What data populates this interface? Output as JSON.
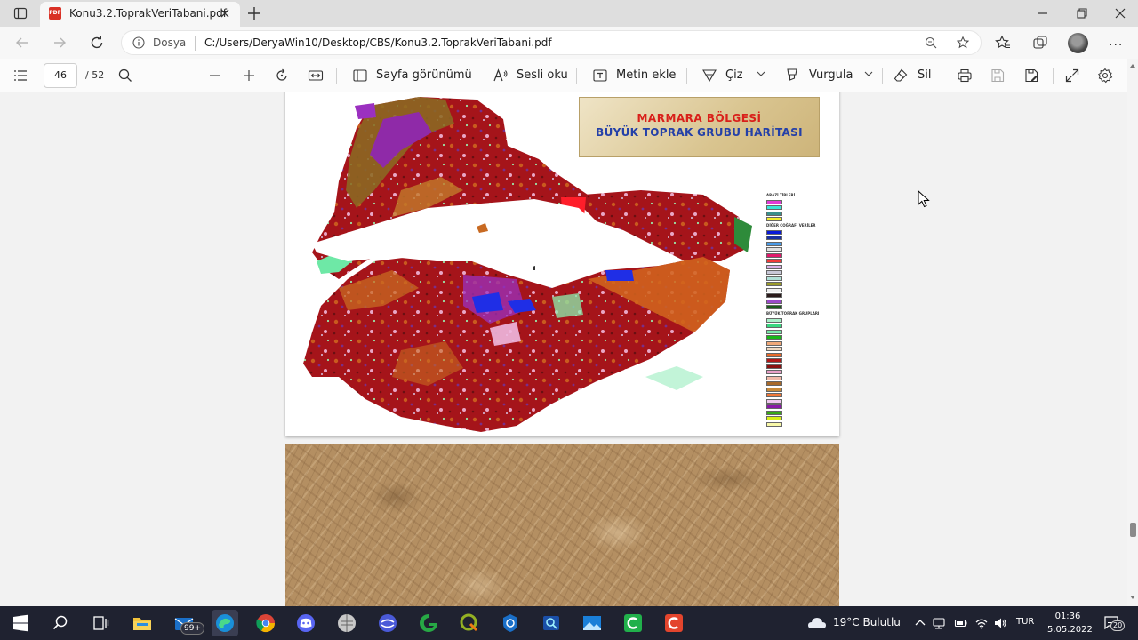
{
  "browser": {
    "tab_title": "Konu3.2.ToprakVeriTabani.pdf",
    "pdf_badge": "PDF",
    "site_label": "Dosya",
    "url": "C:/Users/DeryaWin10/Desktop/CBS/Konu3.2.ToprakVeriTabani.pdf",
    "more_label": "···"
  },
  "pdf_toolbar": {
    "current_page": "46",
    "total_pages": "/ 52",
    "page_view_label": "Sayfa görünümü",
    "read_aloud_label": "Sesli oku",
    "add_text_label": "Metin ekle",
    "draw_label": "Çiz",
    "highlight_label": "Vurgula",
    "erase_label": "Sil"
  },
  "document": {
    "map_title_line1": "MARMARA BÖLGESİ",
    "map_title_line2": "BÜYÜK TOPRAK GRUBU HARİTASI",
    "legend_sections": [
      {
        "title": "ARAZİ TİPLERİ",
        "items": [
          {
            "color": "#e23ad8",
            "label": ""
          },
          {
            "color": "#39e6d8",
            "label": ""
          },
          {
            "color": "#3a8f8a",
            "label": ""
          },
          {
            "color": "#f2ee2a",
            "label": ""
          }
        ]
      },
      {
        "title": "DİĞER COĞRAFİ VERİLER",
        "items": [
          {
            "color": "#0a1ad8",
            "label": ""
          },
          {
            "color": "#1a30a0",
            "label": ""
          },
          {
            "color": "#4a9ae6",
            "label": ""
          },
          {
            "color": "#e0e0e0",
            "label": ""
          },
          {
            "color": "#e0186a",
            "label": ""
          },
          {
            "color": "#f03a3a",
            "label": ""
          },
          {
            "color": "#d8b0e8",
            "label": ""
          },
          {
            "color": "#c8c8d8",
            "label": ""
          },
          {
            "color": "#b0e0d8",
            "label": ""
          },
          {
            "color": "#9a9a2a",
            "label": ""
          },
          {
            "color": "#f0f0f0",
            "label": ""
          },
          {
            "color": "#2a1a1a",
            "label": ""
          },
          {
            "color": "#9a4ac8",
            "label": ""
          },
          {
            "color": "#1a5a1a",
            "label": ""
          }
        ]
      },
      {
        "title": "BÜYÜK TOPRAK GRUPLARI",
        "items": [
          {
            "color": "#a8f0c8",
            "label": ""
          },
          {
            "color": "#38d880",
            "label": ""
          },
          {
            "color": "#78e8a8",
            "label": ""
          },
          {
            "color": "#18b818",
            "label": ""
          },
          {
            "color": "#f0a878",
            "label": ""
          },
          {
            "color": "#f0d8c0",
            "label": ""
          },
          {
            "color": "#e86a2a",
            "label": ""
          },
          {
            "color": "#b01818",
            "label": ""
          },
          {
            "color": "#8a1010",
            "label": ""
          },
          {
            "color": "#e8a0c8",
            "label": ""
          },
          {
            "color": "#f0b8a8",
            "label": ""
          },
          {
            "color": "#a86a2a",
            "label": ""
          },
          {
            "color": "#c88a3a",
            "label": ""
          },
          {
            "color": "#f07838",
            "label": ""
          },
          {
            "color": "#f0c8f0",
            "label": ""
          },
          {
            "color": "#8a18a8",
            "label": ""
          },
          {
            "color": "#38a818",
            "label": ""
          },
          {
            "color": "#d8f018",
            "label": ""
          },
          {
            "color": "#f8f8a8",
            "label": ""
          }
        ]
      }
    ]
  },
  "taskbar": {
    "mail_badge": "99+",
    "weather": "19°C  Bulutlu",
    "language": "TUR",
    "time": "01:36",
    "date": "5.05.2022",
    "notifications": "20"
  }
}
